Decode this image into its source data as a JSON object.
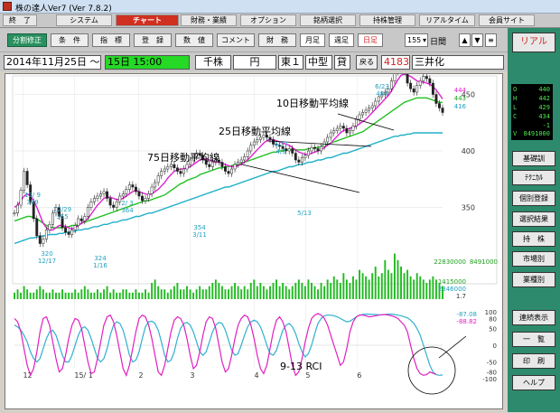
{
  "window": {
    "title": "株の達人Ver7 (Ver 7.8.2)"
  },
  "menu": [
    "終　了",
    "システム",
    "チャート",
    "財務・業績",
    "オプション",
    "銘柄選択",
    "持株管理",
    "リアルタイム",
    "会員サイト"
  ],
  "toolbar": {
    "buttons": [
      "分割修正",
      "条　件",
      "指　標",
      "登　録",
      "数　値",
      "コメント",
      "財　務",
      "月足",
      "週足",
      "日足"
    ],
    "period": "155",
    "period_unit": "日間"
  },
  "info": {
    "date": "2014年11月25日 ～",
    "time": "15日 15:00",
    "market": "千株",
    "currency": "円",
    "exchange": "東１",
    "size": "中型",
    "lend": "貸",
    "back": "戻る",
    "code": "4183",
    "name": "三井化"
  },
  "right": {
    "buttons": [
      "リアル",
      "基礎訓",
      "ﾃｸﾆｶﾙ",
      "個別登録",
      "選択結果",
      "持　株",
      "市場別",
      "業種別",
      "連続表示",
      "一　覧",
      "印　刷",
      "ヘルプ"
    ]
  },
  "quote": [
    {
      "k": "O",
      "v": "440"
    },
    {
      "k": "H",
      "v": "442"
    },
    {
      "k": "L",
      "v": "429"
    },
    {
      "k": "C",
      "v": "434"
    },
    {
      "k": "",
      "v": "-1"
    },
    {
      "k": "V",
      "v": "8491000"
    }
  ],
  "chart_data": {
    "type": "line",
    "title": "",
    "annotations": [
      "10日移動平均線",
      "25日移動平均線",
      "75日移動平均線",
      "9-13  RCI"
    ],
    "price_labels": [
      {
        "text": "12/ 9",
        "sub": "389"
      },
      {
        "text": "12/29",
        "sub": "355"
      },
      {
        "text": "2/ 3",
        "sub": "364"
      },
      {
        "text": "4/27",
        "sub": "4/3"
      },
      {
        "text": "6/23",
        "sub": "486"
      },
      {
        "text": "320",
        "sub": "12/17"
      },
      {
        "text": "324",
        "sub": "1/16"
      },
      {
        "text": "354",
        "sub": "3/11"
      },
      {
        "text": "5/13",
        "sub": ""
      }
    ],
    "ma_legend": [
      "444",
      "443",
      "416"
    ],
    "y_ticks": [
      "450",
      "400",
      "350"
    ],
    "volume_labels": [
      "22830000",
      "8491000",
      "1415000",
      "2346000",
      "1.7"
    ],
    "rci_values": [
      "-87.08",
      "-88.82"
    ],
    "rci_ticks": [
      "100",
      "80",
      "50",
      "0",
      "-50",
      "-80",
      "-100"
    ],
    "x_labels": [
      "12",
      "15/ 1",
      "2",
      "3",
      "4",
      "5",
      "6"
    ],
    "close": [
      345,
      352,
      365,
      382,
      370,
      355,
      340,
      325,
      318,
      322,
      330,
      335,
      345,
      350,
      342,
      332,
      328,
      326,
      330,
      334,
      340,
      338,
      342,
      350,
      355,
      358,
      360,
      362,
      364,
      358,
      352,
      350,
      355,
      360,
      362,
      366,
      370,
      368,
      364,
      360,
      356,
      358,
      362,
      368,
      372,
      378,
      382,
      384,
      386,
      388,
      385,
      382,
      380,
      384,
      388,
      392,
      395,
      398,
      396,
      392,
      388,
      386,
      390,
      392,
      390,
      386,
      382,
      380,
      384,
      388,
      390,
      392,
      395,
      400,
      405,
      408,
      410,
      412,
      414,
      412,
      410,
      406,
      405,
      404,
      402,
      400,
      402,
      398,
      392,
      390,
      394,
      396,
      400,
      403,
      402,
      400,
      404,
      408,
      412,
      416,
      418,
      420,
      422,
      420,
      416,
      418,
      422,
      428,
      432,
      434,
      436,
      438,
      440,
      444,
      448,
      450,
      452,
      455,
      462,
      470,
      478,
      486,
      470,
      460,
      455,
      452,
      458,
      462,
      466,
      464,
      460,
      450,
      442,
      438,
      434
    ],
    "ma10": [
      350,
      352,
      356,
      360,
      362,
      360,
      356,
      350,
      343,
      336,
      332,
      330,
      330,
      332,
      334,
      334,
      333,
      332,
      331,
      332,
      334,
      336,
      338,
      340,
      344,
      348,
      352,
      355,
      358,
      359,
      359,
      358,
      357,
      357,
      358,
      360,
      362,
      364,
      365,
      364,
      363,
      362,
      361,
      362,
      364,
      366,
      369,
      372,
      376,
      379,
      382,
      383,
      384,
      384,
      385,
      386,
      388,
      390,
      392,
      393,
      393,
      392,
      391,
      390,
      390,
      389,
      388,
      387,
      386,
      386,
      387,
      388,
      390,
      392,
      395,
      398,
      401,
      404,
      407,
      409,
      410,
      410,
      409,
      408,
      407,
      406,
      405,
      403,
      401,
      399,
      398,
      397,
      397,
      398,
      399,
      400,
      401,
      403,
      405,
      407,
      410,
      413,
      416,
      418,
      419,
      420,
      421,
      422,
      424,
      426,
      428,
      431,
      434,
      437,
      440,
      443,
      446,
      449,
      453,
      458,
      463,
      467,
      468,
      467,
      466,
      464,
      462,
      461,
      461,
      460,
      459,
      457,
      454,
      450,
      446
    ],
    "ma25": [
      338,
      339,
      340,
      341,
      342,
      342,
      341,
      340,
      338,
      336,
      334,
      333,
      332,
      332,
      332,
      332,
      333,
      333,
      334,
      334,
      335,
      336,
      337,
      338,
      339,
      340,
      341,
      342,
      343,
      344,
      345,
      346,
      347,
      348,
      349,
      350,
      351,
      352,
      353,
      354,
      355,
      356,
      356,
      357,
      358,
      359,
      360,
      361,
      363,
      365,
      367,
      369,
      371,
      372,
      374,
      375,
      376,
      377,
      379,
      380,
      381,
      382,
      383,
      384,
      385,
      385,
      386,
      386,
      387,
      388,
      388,
      389,
      390,
      391,
      392,
      393,
      394,
      395,
      396,
      397,
      398,
      399,
      399,
      400,
      400,
      401,
      401,
      401,
      401,
      401,
      401,
      401,
      402,
      402,
      403,
      403,
      404,
      405,
      406,
      407,
      408,
      409,
      410,
      411,
      412,
      413,
      414,
      415,
      416,
      417,
      419,
      421,
      423,
      425,
      427,
      429,
      431,
      433,
      435,
      437,
      439,
      441,
      443,
      444,
      445,
      446,
      447,
      447,
      447,
      447,
      446,
      445,
      444,
      443,
      443
    ],
    "ma75": [
      318,
      319,
      320,
      321,
      322,
      323,
      323,
      324,
      324,
      325,
      325,
      326,
      326,
      326,
      327,
      327,
      328,
      328,
      329,
      329,
      330,
      330,
      331,
      331,
      332,
      333,
      333,
      334,
      335,
      335,
      336,
      337,
      337,
      338,
      339,
      339,
      340,
      341,
      342,
      342,
      343,
      344,
      345,
      345,
      346,
      347,
      348,
      349,
      350,
      351,
      352,
      353,
      354,
      355,
      356,
      357,
      358,
      359,
      360,
      361,
      362,
      363,
      364,
      365,
      366,
      367,
      368,
      368,
      369,
      370,
      371,
      372,
      373,
      374,
      375,
      376,
      377,
      378,
      379,
      380,
      381,
      382,
      382,
      383,
      384,
      385,
      386,
      386,
      387,
      388,
      388,
      389,
      390,
      390,
      391,
      392,
      392,
      393,
      394,
      394,
      395,
      396,
      397,
      398,
      398,
      399,
      400,
      401,
      402,
      403,
      404,
      405,
      406,
      407,
      408,
      409,
      410,
      411,
      412,
      413,
      413,
      414,
      414,
      415,
      415,
      416,
      416,
      416,
      416,
      416,
      416,
      416,
      416,
      416,
      416
    ],
    "volume": [
      2,
      3,
      2,
      4,
      3,
      2,
      2,
      3,
      4,
      3,
      2,
      2,
      3,
      2,
      2,
      3,
      2,
      2,
      2,
      3,
      2,
      3,
      4,
      3,
      2,
      2,
      3,
      2,
      3,
      4,
      2,
      3,
      2,
      2,
      3,
      3,
      2,
      2,
      3,
      2,
      2,
      3,
      2,
      5,
      6,
      4,
      3,
      3,
      2,
      3,
      4,
      5,
      3,
      3,
      4,
      3,
      2,
      3,
      4,
      3,
      3,
      4,
      5,
      6,
      5,
      4,
      3,
      3,
      4,
      5,
      4,
      3,
      4,
      3,
      5,
      6,
      4,
      5,
      4,
      3,
      4,
      5,
      6,
      4,
      5,
      4,
      3,
      4,
      5,
      6,
      5,
      4,
      6,
      5,
      4,
      3,
      5,
      4,
      6,
      5,
      7,
      6,
      5,
      8,
      6,
      5,
      7,
      6,
      9,
      8,
      7,
      6,
      8,
      10,
      7,
      8,
      12,
      9,
      8,
      14,
      12,
      10,
      8,
      9,
      7,
      6,
      8,
      7,
      6,
      5,
      6,
      7,
      6,
      5,
      4
    ],
    "rci9": [
      80,
      70,
      40,
      -10,
      -60,
      -90,
      -70,
      -20,
      40,
      80,
      85,
      60,
      10,
      -40,
      -80,
      -70,
      -30,
      20,
      60,
      80,
      75,
      50,
      0,
      -50,
      -85,
      -80,
      -40,
      10,
      60,
      85,
      90,
      70,
      30,
      -20,
      -70,
      -90,
      -60,
      -10,
      40,
      80,
      90,
      85,
      60,
      20,
      -30,
      -80,
      -90,
      -60,
      -10,
      40,
      75,
      85,
      80,
      60,
      20,
      -30,
      -70,
      -60,
      -20,
      30,
      70,
      85,
      80,
      50,
      0,
      -50,
      -80,
      -70,
      -30,
      20,
      60,
      80,
      90,
      85,
      60,
      20,
      -30,
      -70,
      -85,
      -60,
      -10,
      40,
      75,
      85,
      70,
      40,
      -10,
      -60,
      -90,
      -80,
      -40,
      10,
      50,
      80,
      90,
      95,
      90,
      80,
      60,
      30,
      0,
      -30,
      -60,
      -50,
      -10,
      40,
      70,
      85,
      90,
      90,
      88,
      85,
      86,
      88,
      90,
      91,
      92,
      90,
      88,
      85,
      80,
      70,
      60,
      40,
      0,
      -40,
      -70,
      -85,
      -90,
      -88,
      -80,
      -84,
      -87
    ],
    "rci13": [
      60,
      55,
      45,
      30,
      10,
      -20,
      -40,
      -50,
      -40,
      -10,
      20,
      40,
      45,
      30,
      0,
      -30,
      -50,
      -50,
      -30,
      0,
      30,
      50,
      55,
      45,
      20,
      -10,
      -40,
      -50,
      -40,
      -10,
      30,
      60,
      70,
      65,
      45,
      10,
      -30,
      -50,
      -45,
      -20,
      20,
      55,
      70,
      72,
      65,
      45,
      10,
      -30,
      -50,
      -45,
      -20,
      20,
      50,
      65,
      68,
      60,
      40,
      10,
      -20,
      -30,
      -20,
      10,
      40,
      60,
      68,
      65,
      45,
      15,
      -15,
      -30,
      -25,
      0,
      30,
      55,
      70,
      75,
      70,
      55,
      30,
      0,
      -25,
      -30,
      -15,
      15,
      45,
      60,
      65,
      55,
      35,
      5,
      -20,
      -35,
      -25,
      0,
      35,
      65,
      80,
      88,
      90,
      90,
      88,
      85,
      80,
      75,
      70,
      72,
      78,
      85,
      90,
      92,
      93,
      93,
      92,
      92,
      91,
      91,
      92,
      93,
      93,
      92,
      90,
      88,
      85,
      82,
      75,
      65,
      50,
      30,
      0,
      -30,
      -60,
      -80,
      -88,
      -90,
      -89
    ]
  }
}
